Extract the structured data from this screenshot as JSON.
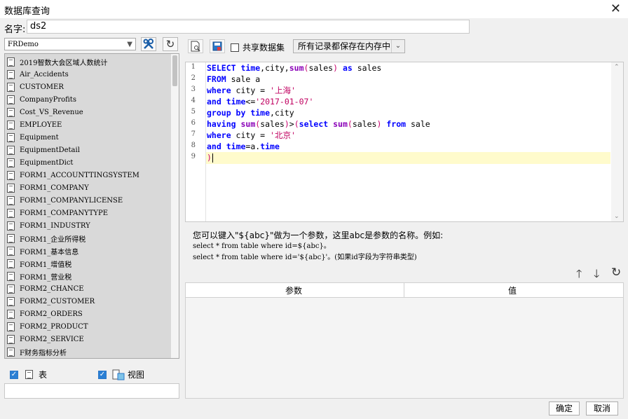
{
  "window": {
    "title": "数据库查询",
    "name_label": "名字:",
    "name_value": "ds2"
  },
  "datasource": {
    "selected": "FRDemo",
    "tables": [
      "2019智数大会区域人数统计",
      "Air_Accidents",
      "CUSTOMER",
      "CompanyProfits",
      "Cost_VS_Revenue",
      "EMPLOYEE",
      "Equipment",
      "EquipmentDetail",
      "EquipmentDict",
      "FORM1_ACCOUNTTINGSYSTEM",
      "FORM1_COMPANY",
      "FORM1_COMPANYLICENSE",
      "FORM1_COMPANYTYPE",
      "FORM1_INDUSTRY",
      "FORM1_企业所得税",
      "FORM1_基本信息",
      "FORM1_增值税",
      "FORM1_营业税",
      "FORM2_CHANCE",
      "FORM2_CUSTOMER",
      "FORM2_ORDERS",
      "FORM2_PRODUCT",
      "FORM2_SERVICE",
      "F财务指标分析"
    ],
    "show_table_label": "表",
    "show_view_label": "视图",
    "show_table_checked": true,
    "show_view_checked": true
  },
  "toolbar": {
    "share_label": "共享数据集",
    "memory_option": "所有记录都保存在内存中"
  },
  "editor": {
    "line_numbers": [
      "1",
      "2",
      "3",
      "4",
      "5",
      "6",
      "7",
      "8",
      "9"
    ],
    "lines": [
      [
        {
          "t": "SELECT ",
          "c": "kw"
        },
        {
          "t": "time",
          "c": "kw"
        },
        {
          "t": ",city,",
          "c": ""
        },
        {
          "t": "sum",
          "c": "fn"
        },
        {
          "t": "(",
          "c": "pn"
        },
        {
          "t": "sales",
          "c": ""
        },
        {
          "t": ")",
          "c": "pn"
        },
        {
          "t": " ",
          "c": ""
        },
        {
          "t": "as",
          "c": "kw"
        },
        {
          "t": " sales",
          "c": ""
        }
      ],
      [
        {
          "t": "FROM",
          "c": "kw"
        },
        {
          "t": " sale a",
          "c": ""
        }
      ],
      [
        {
          "t": "where",
          "c": "kw"
        },
        {
          "t": " city = ",
          "c": ""
        },
        {
          "t": "'上海'",
          "c": "st"
        }
      ],
      [
        {
          "t": "and",
          "c": "kw"
        },
        {
          "t": " ",
          "c": ""
        },
        {
          "t": "time",
          "c": "kw"
        },
        {
          "t": "<=",
          "c": ""
        },
        {
          "t": "'2017-01-07'",
          "c": "st"
        }
      ],
      [
        {
          "t": "group by",
          "c": "kw"
        },
        {
          "t": " ",
          "c": ""
        },
        {
          "t": "time",
          "c": "kw"
        },
        {
          "t": ",city",
          "c": ""
        }
      ],
      [
        {
          "t": "having",
          "c": "kw"
        },
        {
          "t": " ",
          "c": ""
        },
        {
          "t": "sum",
          "c": "fn"
        },
        {
          "t": "(",
          "c": "pn"
        },
        {
          "t": "sales",
          "c": ""
        },
        {
          "t": ")",
          "c": "pn"
        },
        {
          "t": ">",
          "c": ""
        },
        {
          "t": "(",
          "c": "pn"
        },
        {
          "t": "select",
          "c": "kw"
        },
        {
          "t": " ",
          "c": ""
        },
        {
          "t": "sum",
          "c": "fn"
        },
        {
          "t": "(",
          "c": "pn"
        },
        {
          "t": "sales",
          "c": ""
        },
        {
          "t": ")",
          "c": "pn"
        },
        {
          "t": " ",
          "c": ""
        },
        {
          "t": "from",
          "c": "kw"
        },
        {
          "t": " sale",
          "c": ""
        }
      ],
      [
        {
          "t": "where",
          "c": "kw"
        },
        {
          "t": " city = ",
          "c": ""
        },
        {
          "t": "'北京'",
          "c": "st"
        }
      ],
      [
        {
          "t": "and",
          "c": "kw"
        },
        {
          "t": " ",
          "c": ""
        },
        {
          "t": "time",
          "c": "kw"
        },
        {
          "t": "=a.",
          "c": ""
        },
        {
          "t": "time",
          "c": "kw"
        }
      ],
      [
        {
          "t": ")",
          "c": "pn"
        }
      ]
    ]
  },
  "hint": {
    "line1": "您可以键入\"${abc}\"做为一个参数，这里abc是参数的名称。例如:",
    "line2": "select * from table where id=${abc}。",
    "line3": "select * from table where id='${abc}'。(如果id字段为字符串类型)"
  },
  "params": {
    "col_param": "参数",
    "col_value": "值"
  },
  "buttons": {
    "ok": "确定",
    "cancel": "取消"
  }
}
